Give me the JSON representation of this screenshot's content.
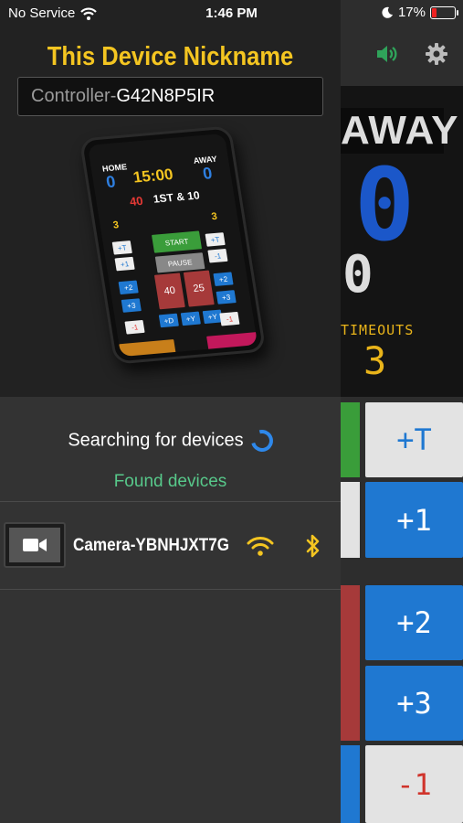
{
  "status": {
    "carrier": "No Service",
    "time": "1:46 PM",
    "battery": "17%",
    "battery_level": 0.17
  },
  "panel": {
    "title": "This Device Nickname",
    "nickname_prefix": "Controller-",
    "nickname_value": "G42N8P5IR",
    "searching_text": "Searching for devices",
    "found_label": "Found devices",
    "devices": [
      {
        "name": "Camera-YBNHJXT7G",
        "icon": "video-camera-icon",
        "wifi": true,
        "bluetooth": true
      }
    ]
  },
  "phone_preview": {
    "home": "HOME",
    "away": "AWAY",
    "home_score": "0",
    "away_score": "0",
    "clock": "15:00",
    "points": "40",
    "down": "1ST & 10",
    "start": "START",
    "pause": "PAUSE",
    "reset_a": "40",
    "reset_b": "25"
  },
  "scoreboard": {
    "away_label": "AWAY",
    "away_score": "0",
    "secondary_value": "0",
    "timeouts_label": "TIMEOUTS",
    "timeouts_value": "3",
    "buttons": [
      "+T",
      "+1",
      "+2",
      "+3",
      "-1"
    ],
    "colors": {
      "blue": "#1f78d1",
      "gray": "#e3e3e3",
      "green": "#3a9d3a",
      "red": "#a63a3a",
      "gold": "#e9b41a"
    }
  }
}
